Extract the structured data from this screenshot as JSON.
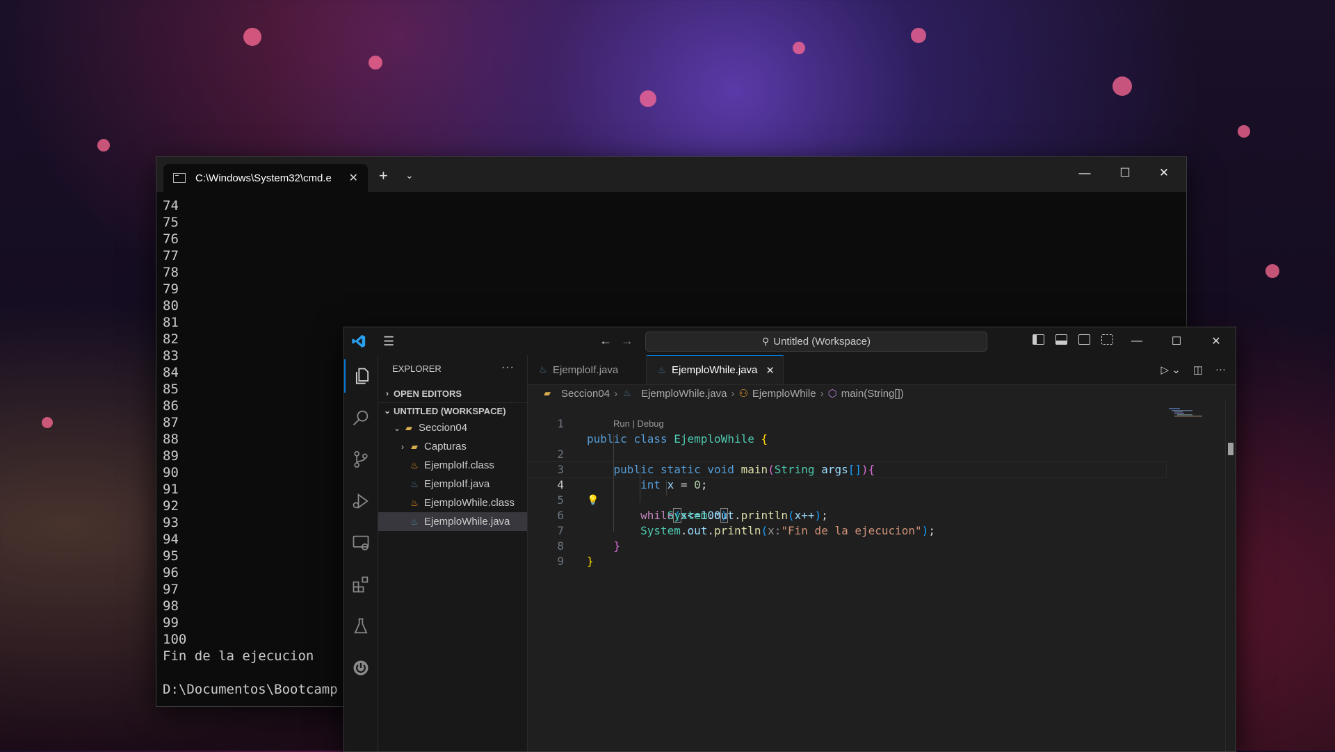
{
  "terminal": {
    "tab_title": "C:\\Windows\\System32\\cmd.e",
    "output_lines": [
      "74",
      "75",
      "76",
      "77",
      "78",
      "79",
      "80",
      "81",
      "82",
      "83",
      "84",
      "85",
      "86",
      "87",
      "88",
      "89",
      "90",
      "91",
      "92",
      "93",
      "94",
      "95",
      "96",
      "97",
      "98",
      "99",
      "100",
      "Fin de la ejecucion",
      "",
      "D:\\Documentos\\Bootcamp"
    ]
  },
  "vscode": {
    "command_center": "Untitled (Workspace)",
    "sidebar": {
      "title": "EXPLORER",
      "open_editors": "OPEN EDITORS",
      "workspace": "UNTITLED (WORKSPACE)",
      "folder": "Seccion04",
      "subfolder": "Capturas",
      "files": [
        "EjemploIf.class",
        "EjemploIf.java",
        "EjemploWhile.class",
        "EjemploWhile.java"
      ],
      "selected_file": "EjemploWhile.java"
    },
    "tabs": [
      {
        "label": "EjemploIf.java",
        "active": false
      },
      {
        "label": "EjemploWhile.java",
        "active": true
      }
    ],
    "breadcrumbs": [
      "Seccion04",
      "EjemploWhile.java",
      "EjemploWhile",
      "main(String[])"
    ],
    "codelens": "Run | Debug",
    "line_numbers": [
      "1",
      "2",
      "3",
      "4",
      "5",
      "6",
      "7",
      "8",
      "9"
    ],
    "current_line": "4",
    "code": {
      "l1": {
        "t1": "public",
        "t2": "class",
        "t3": "EjemploWhile",
        "t4": "{"
      },
      "l2": {
        "t1": "public",
        "t2": "static",
        "t3": "void",
        "t4": "main",
        "t5": "(",
        "t6": "String",
        "t7": "args",
        "t8": "[]",
        "t9": ")",
        "t10": "{"
      },
      "l3": {
        "t1": "int",
        "t2": "x",
        "t3": "=",
        "t4": "0",
        "t5": ";"
      },
      "l4": {
        "t1": "while",
        "t2": "(",
        "t3": "x<=100",
        "t4": ")"
      },
      "l5": {
        "t1": "System",
        "t2": ".",
        "t3": "out",
        "t4": ".",
        "t5": "println",
        "t6": "(",
        "t7": "x++",
        "t8": ")",
        "t9": ";"
      },
      "l6": {
        "t1": "System",
        "t2": ".",
        "t3": "out",
        "t4": ".",
        "t5": "println",
        "t6": "(",
        "t7": "x:",
        "t8": "\"Fin de la ejecucion\"",
        "t9": ")",
        "t10": ";"
      },
      "l7": {
        "t1": "}"
      },
      "l8": {
        "t1": "}"
      }
    }
  }
}
